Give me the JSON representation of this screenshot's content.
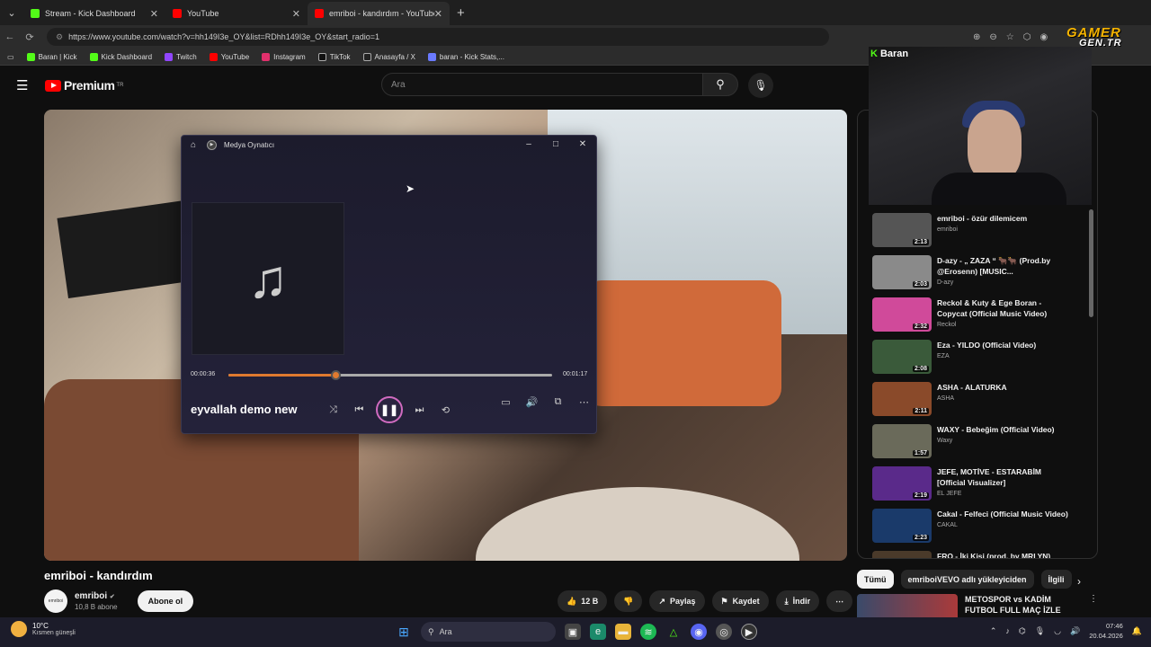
{
  "browser": {
    "tabs": [
      {
        "title": "Stream - Kick Dashboard",
        "color": "#53fc18",
        "active": false
      },
      {
        "title": "YouTube",
        "color": "#ff0000",
        "active": false
      },
      {
        "title": "emriboi - kandırdım - YouTube",
        "color": "#ff0000",
        "active": true
      }
    ],
    "url": "https://www.youtube.com/watch?v=hh149I3e_OY&list=RDhh149I3e_OY&start_radio=1",
    "bookmarks": [
      {
        "label": "Baran | Kick",
        "color": "#53fc18"
      },
      {
        "label": "Kick Dashboard",
        "color": "#53fc18"
      },
      {
        "label": "Twitch",
        "color": "#9146ff"
      },
      {
        "label": "YouTube",
        "color": "#ff0000"
      },
      {
        "label": "Instagram",
        "color": "#e1306c"
      },
      {
        "label": "TikTok",
        "color": "#111111"
      },
      {
        "label": "Anasayfa / X",
        "color": "#222222"
      },
      {
        "label": "baran - Kick Stats,...",
        "color": "#6a7aff"
      }
    ]
  },
  "youtube": {
    "logo_text": "Premium",
    "logo_region": "TR",
    "search_placeholder": "Ara",
    "video_title": "emriboi - kandırdım",
    "channel_name": "emriboi",
    "subscribers": "10,8 B abone",
    "subscribe_label": "Abone ol",
    "likes": "12 B",
    "share_label": "Paylaş",
    "save_label": "Kaydet",
    "download_label": "İndir"
  },
  "media_player": {
    "app_title": "Medya Oynatıcı",
    "elapsed": "00:00:36",
    "duration": "00:01:17",
    "progress": 0.33,
    "song_title": "eyvallah demo new"
  },
  "playlist": [
    {
      "title": "emriboi - özür dilemicem",
      "channel": "emriboi",
      "duration": "2:13",
      "thumb": "#555555"
    },
    {
      "title": "D-azy - „ ZAZA “ 🐂🐂 (Prod.by @Erosenn) [MUSIC...",
      "channel": "D-azy",
      "duration": "2:03",
      "thumb": "#8a8a8a"
    },
    {
      "title": "Reckol & Kuty & Ege Boran - Copycat (Official Music Video)",
      "channel": "Reckol",
      "duration": "2:32",
      "thumb": "#d04a9a"
    },
    {
      "title": "Eza - YILDO (Official Video)",
      "channel": "EZA",
      "duration": "2:08",
      "thumb": "#3a5a3a"
    },
    {
      "title": "ASHA - ALATURKA",
      "channel": "ASHA",
      "duration": "2:11",
      "thumb": "#8a4a2a"
    },
    {
      "title": "WAXY - Bebeğim (Official Video)",
      "channel": "Waxy",
      "duration": "1:57",
      "thumb": "#6a6a5a"
    },
    {
      "title": "JEFE, MOTİVE - ESTARABİM [Official Visualizer]",
      "channel": "EL JEFE",
      "duration": "2:19",
      "thumb": "#5a2a8a"
    },
    {
      "title": "Cakal - Felfeci (Official Music Video)",
      "channel": "CAKAL",
      "duration": "2:23",
      "thumb": "#1a3a6a"
    },
    {
      "title": "FRO - İki Kişi (prod. by MRLYN)",
      "channel": "FRO",
      "duration": "",
      "thumb": "#4a3a2a"
    }
  ],
  "chips": [
    "Tümü",
    "emriboiVEVO adlı yükleyiciden",
    "İlgili"
  ],
  "recommended": {
    "title": "METOSPOR vs KADİM FUTBOL FULL MAÇ İZLE"
  },
  "webcam": {
    "label": "Baran"
  },
  "watermark": {
    "top": "GAMER",
    "bottom": "GEN.TR"
  },
  "taskbar": {
    "temp": "10°C",
    "condition": "Kısmen güneşli",
    "search": "Ara",
    "time": "07:46",
    "date": "20.04.2026"
  }
}
